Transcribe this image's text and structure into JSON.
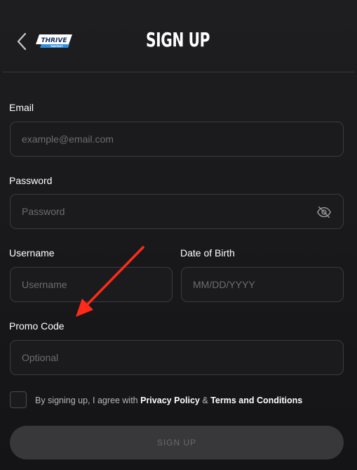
{
  "header": {
    "title": "SIGN UP",
    "logo_text": "THRIVE",
    "logo_subtext": "FANTASY"
  },
  "form": {
    "email": {
      "label": "Email",
      "placeholder": "example@email.com",
      "value": ""
    },
    "password": {
      "label": "Password",
      "placeholder": "Password",
      "value": ""
    },
    "username": {
      "label": "Username",
      "placeholder": "Username",
      "value": ""
    },
    "dob": {
      "label": "Date of Birth",
      "placeholder": "MM/DD/YYYY",
      "value": ""
    },
    "promo": {
      "label": "Promo Code",
      "placeholder": "Optional",
      "value": ""
    }
  },
  "terms": {
    "prefix": "By signing up, I agree with",
    "privacy_link": "Privacy Policy",
    "joiner": "&",
    "terms_link": "Terms and Conditions",
    "checked": false
  },
  "submit_label": "SIGN UP",
  "icons": {
    "back": "chevron-left-icon",
    "password_toggle": "eye-off-icon"
  },
  "colors": {
    "background": "#1e1e21",
    "field_border": "#3b3b40",
    "button_disabled": "#38383b",
    "annotation_arrow": "#ff2a1a"
  }
}
